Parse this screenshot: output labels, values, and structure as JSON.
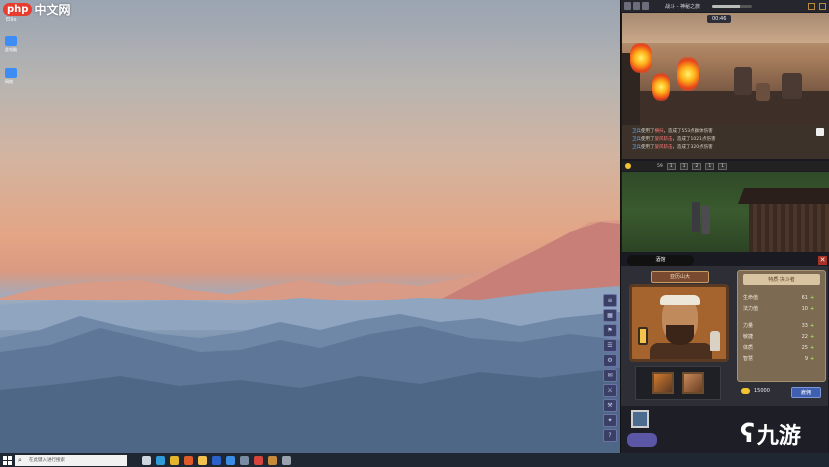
{
  "watermark": {
    "logo": "php",
    "text": "中文网",
    "sub": "Ellio"
  },
  "desktop_icons": [
    {
      "label": "此电脑",
      "color": "#3d8df5"
    },
    {
      "label": "网络",
      "color": "#3d8df5"
    }
  ],
  "game": {
    "title": "战斗 - 神秘之旅",
    "battle_timer": "00:46",
    "hp_bar_fraction": 0.7,
    "combat_log": [
      {
        "who": "卫兵",
        "mid": "使用了",
        "skill": "横扫",
        "rest": "，造成了553点群体伤害"
      },
      {
        "who": "卫兵",
        "mid": "使用了",
        "skill": "旋风斩击",
        "rest": "，造成了1021点伤害"
      },
      {
        "who": "卫兵",
        "mid": "使用了",
        "skill": "旋风斩击",
        "rest": "，造成了320点伤害"
      }
    ],
    "speed_bar": {
      "value": "59",
      "toggles": [
        "1",
        "1",
        "2",
        "1",
        "1"
      ]
    },
    "hero_tab": "酒馆",
    "hero": {
      "name": "亚历山大",
      "rank": "特质·决斗者",
      "stats_top": [
        {
          "label": "生命值",
          "value": "61",
          "plus": "+"
        },
        {
          "label": "法力值",
          "value": "10",
          "plus": "+"
        }
      ],
      "stats_bottom": [
        {
          "label": "力量",
          "value": "33",
          "plus": "+"
        },
        {
          "label": "敏捷",
          "value": "22",
          "plus": "+"
        },
        {
          "label": "体质",
          "value": "25",
          "plus": "+"
        },
        {
          "label": "智慧",
          "value": "9",
          "plus": "+"
        }
      ],
      "gold": "15000",
      "hire_label": "雇佣"
    },
    "close_symbol": "✕",
    "side_buttons": [
      "≡",
      "▦",
      "⚑",
      "☰",
      "⚙",
      "✉",
      "⚔",
      "⚒",
      "✦",
      "?"
    ]
  },
  "brand": {
    "glyph": "ʕ",
    "text": "九游"
  },
  "taskbar": {
    "search_placeholder": "在此键入进行搜索",
    "icons": [
      {
        "name": "task-view-icon",
        "color": "#cfd6e0"
      },
      {
        "name": "edge-icon",
        "color": "#2f9bd8"
      },
      {
        "name": "chrome-icon",
        "color": "#e3b52c"
      },
      {
        "name": "store-icon",
        "color": "#e05a2a"
      },
      {
        "name": "folder-icon",
        "color": "#f2c14e"
      },
      {
        "name": "word-icon",
        "color": "#2b62c9"
      },
      {
        "name": "mail-icon",
        "color": "#3a8ee6"
      },
      {
        "name": "steam-icon",
        "color": "#7a8ca3"
      },
      {
        "name": "media-icon",
        "color": "#d7443e"
      },
      {
        "name": "game-icon",
        "color": "#c88a3a"
      },
      {
        "name": "terminal-icon",
        "color": "#9aa3ad"
      }
    ]
  }
}
